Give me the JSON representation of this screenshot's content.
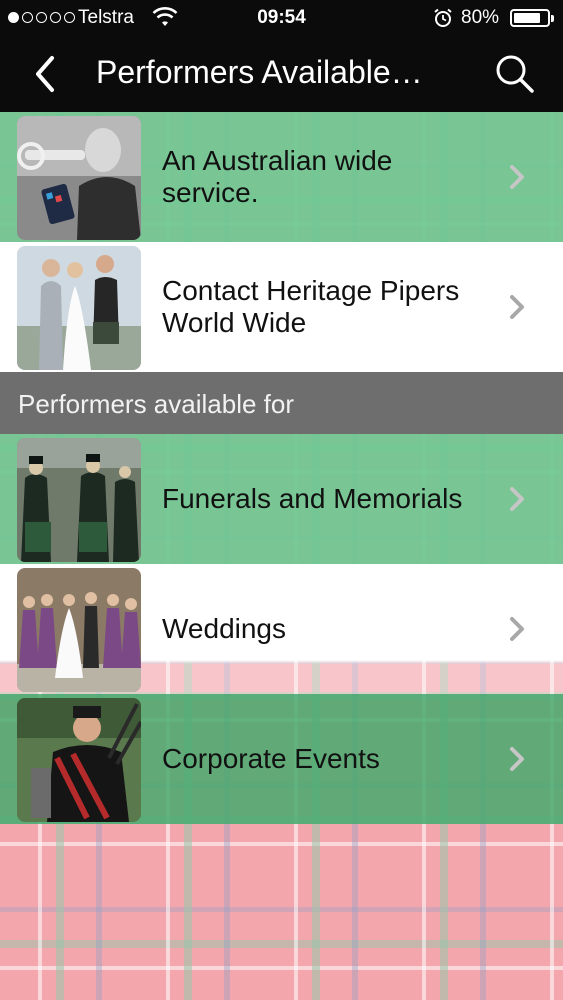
{
  "status_bar": {
    "carrier": "Telstra",
    "time": "09:54",
    "battery_percent_label": "80%",
    "battery_level": 0.8,
    "signal_bars_filled": 1,
    "signal_bars_total": 5
  },
  "nav": {
    "title": "Performers Available…",
    "back_icon": "chevron-left-icon",
    "search_icon": "search-icon"
  },
  "list": {
    "top_items": [
      {
        "label": "An Australian wide service.",
        "thumbnail": "bugler-photo",
        "style": "green"
      },
      {
        "label": "Contact Heritage Pipers World Wide",
        "thumbnail": "wedding-couple-piper-photo",
        "style": "white"
      }
    ],
    "section_header": "Performers available for",
    "section_items": [
      {
        "label": "Funerals and Memorials",
        "thumbnail": "pipe-band-photo",
        "style": "green"
      },
      {
        "label": "Weddings",
        "thumbnail": "wedding-party-photo",
        "style": "white"
      },
      {
        "label": "Corporate Events",
        "thumbnail": "bagpiper-photo",
        "style": "green"
      }
    ]
  },
  "colors": {
    "nav_bg": "#0b0b0b",
    "row_green": "#6ec891",
    "section_header_bg": "#6e6e6e",
    "tartan_base": "#f4a6ad"
  }
}
